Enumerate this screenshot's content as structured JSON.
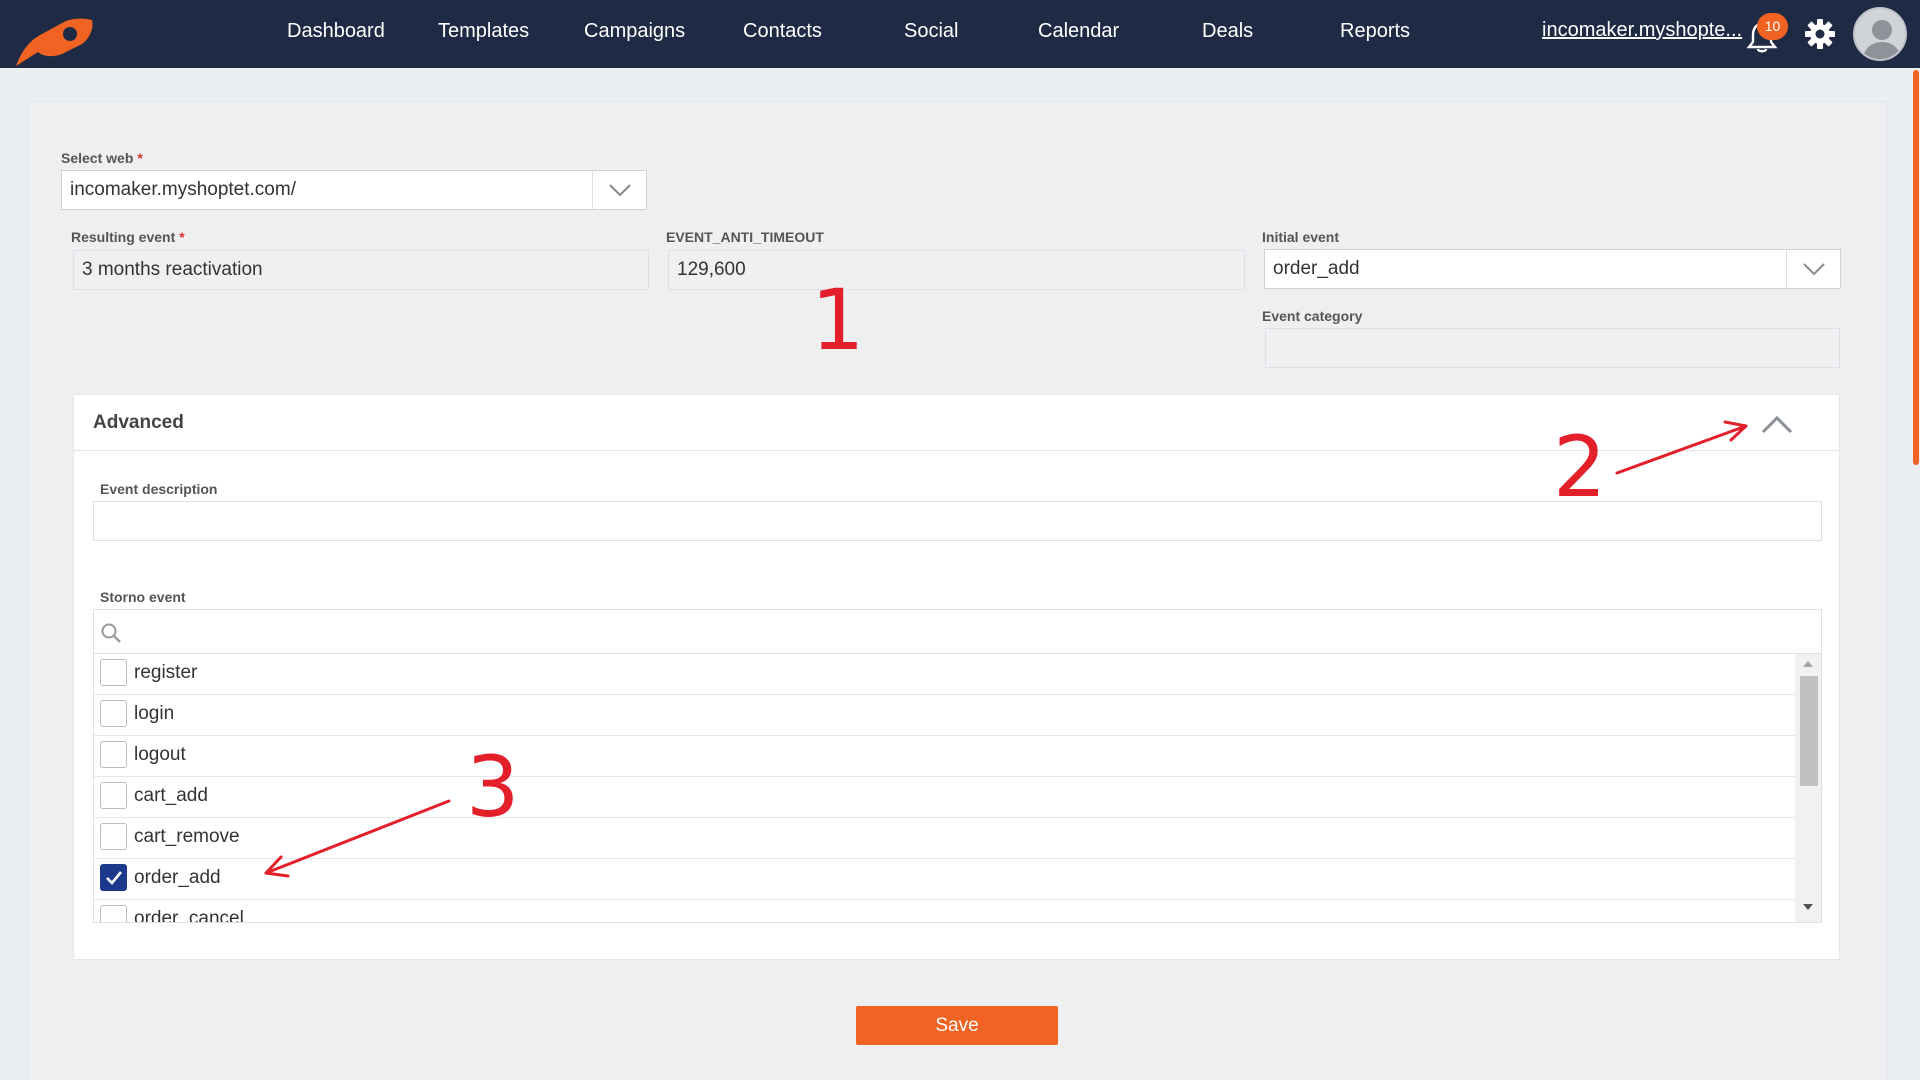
{
  "nav": {
    "items": [
      "Dashboard",
      "Templates",
      "Campaigns",
      "Contacts",
      "Social",
      "Calendar",
      "Deals",
      "Reports"
    ],
    "shop_link": "incomaker.myshopte...",
    "notifications_count": "10"
  },
  "form": {
    "select_web": {
      "label": "Select web",
      "required": "*",
      "value": "incomaker.myshoptet.com/"
    },
    "resulting_event": {
      "label": "Resulting event",
      "required": "*",
      "value": "3 months reactivation"
    },
    "anti_timeout": {
      "label": "EVENT_ANTI_TIMEOUT",
      "value": "129,600"
    },
    "initial_event": {
      "label": "Initial event",
      "value": "order_add"
    },
    "event_category": {
      "label": "Event category",
      "value": ""
    }
  },
  "advanced": {
    "title": "Advanced",
    "event_description": {
      "label": "Event description",
      "value": ""
    },
    "storno_event": {
      "label": "Storno event",
      "search_placeholder": "",
      "options": [
        {
          "label": "register",
          "checked": false
        },
        {
          "label": "login",
          "checked": false
        },
        {
          "label": "logout",
          "checked": false
        },
        {
          "label": "cart_add",
          "checked": false
        },
        {
          "label": "cart_remove",
          "checked": false
        },
        {
          "label": "order_add",
          "checked": true
        },
        {
          "label": "order_cancel",
          "checked": false
        }
      ]
    }
  },
  "annotations": [
    "1",
    "2",
    "3"
  ],
  "save_label": "Save",
  "colors": {
    "topbar": "#1f2b44",
    "accent": "#f06322",
    "checkbox": "#1b3a8c",
    "annotation": "#e3202a"
  }
}
